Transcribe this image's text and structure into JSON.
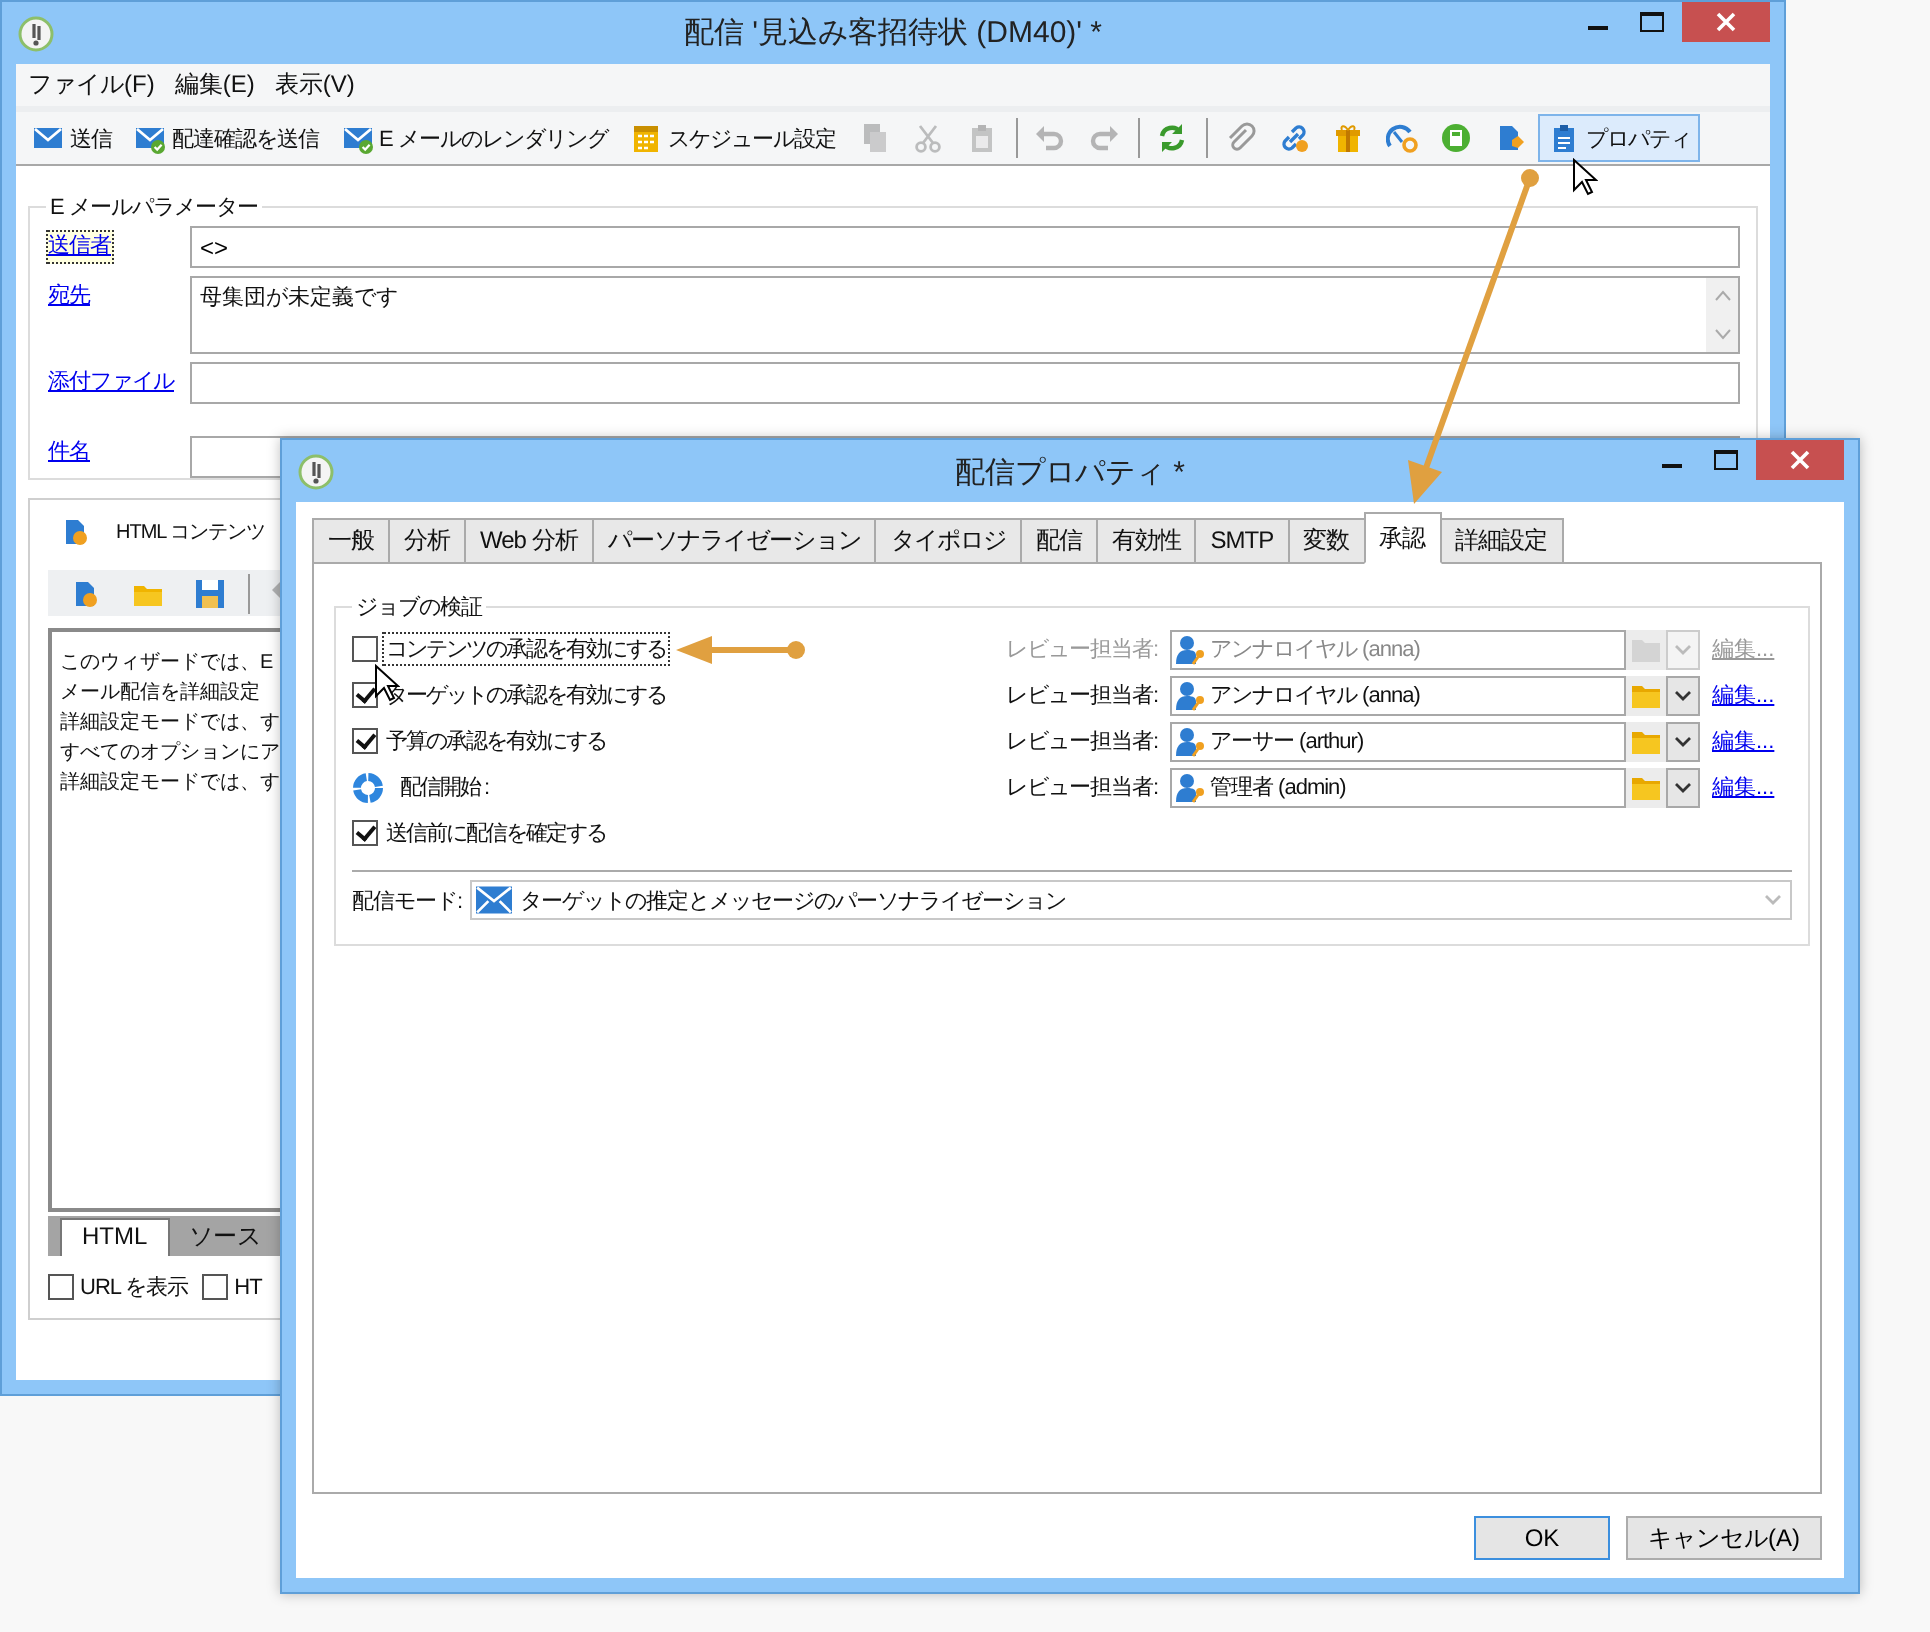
{
  "main_window": {
    "title": "配信 '見込み客招待状 (DM40)' *",
    "menu": [
      "ファイル(F)",
      "編集(E)",
      "表示(V)"
    ],
    "toolbar": [
      {
        "kind": "labeled",
        "label": "送信",
        "disabled": false,
        "hover": false
      },
      {
        "kind": "labeled",
        "label": "配達確認を送信",
        "disabled": false,
        "hover": false
      },
      {
        "kind": "labeled",
        "label": "E メールのレンダリング",
        "disabled": false,
        "hover": false
      },
      {
        "kind": "labeled",
        "label": "スケジュール設定",
        "disabled": false,
        "hover": false
      },
      {
        "kind": "icon",
        "disabled": true,
        "hover": false
      },
      {
        "kind": "icon",
        "disabled": true,
        "hover": false
      },
      {
        "kind": "icon",
        "disabled": true,
        "hover": false
      },
      {
        "kind": "separator"
      },
      {
        "kind": "icon",
        "disabled": true,
        "hover": false
      },
      {
        "kind": "icon",
        "disabled": true,
        "hover": false
      },
      {
        "kind": "separator"
      },
      {
        "kind": "icon",
        "disabled": false,
        "hover": false
      },
      {
        "kind": "separator"
      },
      {
        "kind": "icon",
        "disabled": false,
        "hover": false
      },
      {
        "kind": "icon",
        "disabled": false,
        "hover": false
      },
      {
        "kind": "icon",
        "disabled": false,
        "hover": false
      },
      {
        "kind": "icon",
        "disabled": false,
        "hover": false
      },
      {
        "kind": "icon",
        "disabled": false,
        "hover": false
      },
      {
        "kind": "icon",
        "disabled": false,
        "hover": false
      },
      {
        "kind": "labeled",
        "label": "プロパティ",
        "disabled": false,
        "hover": true
      }
    ],
    "email_parameters": {
      "legend": "E メールパラメーター",
      "fields": [
        {
          "label": "送信者",
          "kind": "line",
          "value": "<>",
          "focused": true
        },
        {
          "label": "宛先",
          "kind": "multiline",
          "value": "母集団が未定義です",
          "focused": false
        },
        {
          "label": "添付ファイル",
          "kind": "line",
          "focused": false
        },
        {
          "label": "件名",
          "kind": "line",
          "focused": false
        }
      ]
    },
    "content_panel": {
      "title": "HTML コンテンツ",
      "toolbar": [
        {
          "kind": "icon",
          "disabled": false
        },
        {
          "kind": "icon",
          "disabled": false
        },
        {
          "kind": "icon",
          "disabled": false
        },
        {
          "kind": "separator"
        },
        {
          "kind": "icon",
          "disabled": true
        }
      ],
      "text_lines": [
        "このウィザードでは、E",
        "メール配信を詳細設定",
        "詳細設定モードでは、す",
        "すべてのオプションにア",
        "詳細設定モードでは、す"
      ],
      "tabs": [
        {
          "label": "HTML",
          "selected": true
        },
        {
          "label": "ソース",
          "selected": false
        }
      ],
      "options": [
        {
          "label": "URL を表示",
          "checked": false
        },
        {
          "label": "HT",
          "checked": false
        }
      ]
    }
  },
  "dialog": {
    "title": "配信プロパティ *",
    "tabs": [
      {
        "label": "一般",
        "selected": false
      },
      {
        "label": "分析",
        "selected": false
      },
      {
        "label": "Web 分析",
        "selected": false
      },
      {
        "label": "パーソナライゼーション",
        "selected": false
      },
      {
        "label": "タイポロジ",
        "selected": false
      },
      {
        "label": "配信",
        "selected": false
      },
      {
        "label": "有効性",
        "selected": false
      },
      {
        "label": "SMTP",
        "selected": false
      },
      {
        "label": "変数",
        "selected": false
      },
      {
        "label": "承認",
        "selected": true
      },
      {
        "label": "詳細設定",
        "selected": false
      }
    ],
    "group": {
      "legend": "ジョブの検証",
      "rows": [
        {
          "kind": "checkbox",
          "label": "コンテンツの承認を有効にする",
          "checked": false,
          "focused": true,
          "reviewer": {
            "label": "レビュー担当者:",
            "value": "アンナロイヤル (anna)",
            "link": "編集...",
            "disabled": true
          }
        },
        {
          "kind": "checkbox",
          "label": "ターゲットの承認を有効にする",
          "checked": true,
          "focused": false,
          "reviewer": {
            "label": "レビュー担当者:",
            "value": "アンナロイヤル (anna)",
            "link": "編集...",
            "disabled": false
          }
        },
        {
          "kind": "checkbox",
          "label": "予算の承認を有効にする",
          "checked": true,
          "focused": false,
          "reviewer": {
            "label": "レビュー担当者:",
            "value": "アーサー (arthur)",
            "link": "編集...",
            "disabled": false
          }
        },
        {
          "kind": "status",
          "label": "配信開始 :",
          "focused": false,
          "reviewer": {
            "label": "レビュー担当者:",
            "value": "管理者 (admin)",
            "link": "編集...",
            "disabled": false
          }
        },
        {
          "kind": "checkbox",
          "label": "送信前に配信を確定する",
          "checked": true,
          "focused": false
        }
      ],
      "mode": {
        "label": "配信モード:",
        "value": "ターゲットの推定とメッセージのパーソナライゼーション",
        "disabled": true
      }
    },
    "buttons": [
      {
        "label": "OK",
        "default": true
      },
      {
        "label": "キャンセル(A)",
        "default": false
      }
    ]
  }
}
